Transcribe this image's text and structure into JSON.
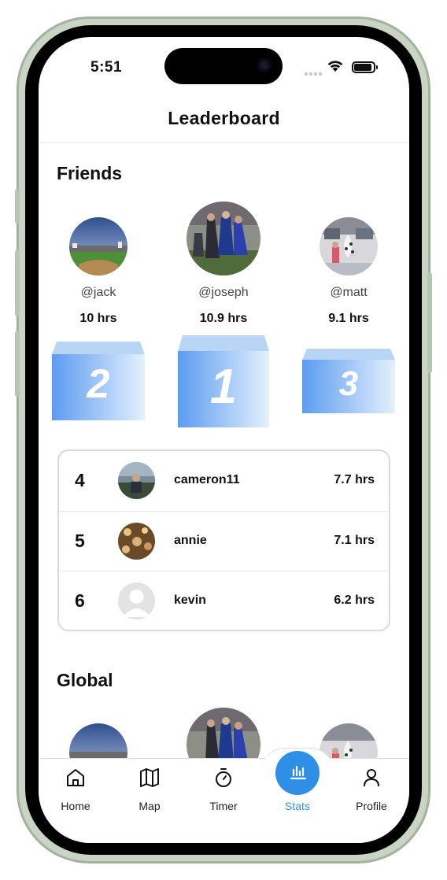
{
  "status_bar": {
    "time": "5:51"
  },
  "header": {
    "title": "Leaderboard"
  },
  "friends": {
    "title": "Friends",
    "podium": [
      {
        "rank": "2",
        "handle": "@jack",
        "hours": "10 hrs"
      },
      {
        "rank": "1",
        "handle": "@joseph",
        "hours": "10.9 hrs"
      },
      {
        "rank": "3",
        "handle": "@matt",
        "hours": "9.1 hrs"
      }
    ],
    "list": [
      {
        "rank": "4",
        "name": "cameron11",
        "hours": "7.7 hrs"
      },
      {
        "rank": "5",
        "name": "annie",
        "hours": "7.1 hrs"
      },
      {
        "rank": "6",
        "name": "kevin",
        "hours": "6.2 hrs"
      }
    ]
  },
  "global": {
    "title": "Global"
  },
  "tabbar": {
    "items": [
      {
        "label": "Home",
        "icon": "home-icon"
      },
      {
        "label": "Map",
        "icon": "map-icon"
      },
      {
        "label": "Timer",
        "icon": "timer-icon"
      },
      {
        "label": "Stats",
        "icon": "stats-icon",
        "active": true
      },
      {
        "label": "Profile",
        "icon": "profile-icon"
      }
    ]
  },
  "colors": {
    "accent": "#2f8fe6",
    "podium_light": "#cfe3fb",
    "podium_dark": "#5c9cf0"
  }
}
